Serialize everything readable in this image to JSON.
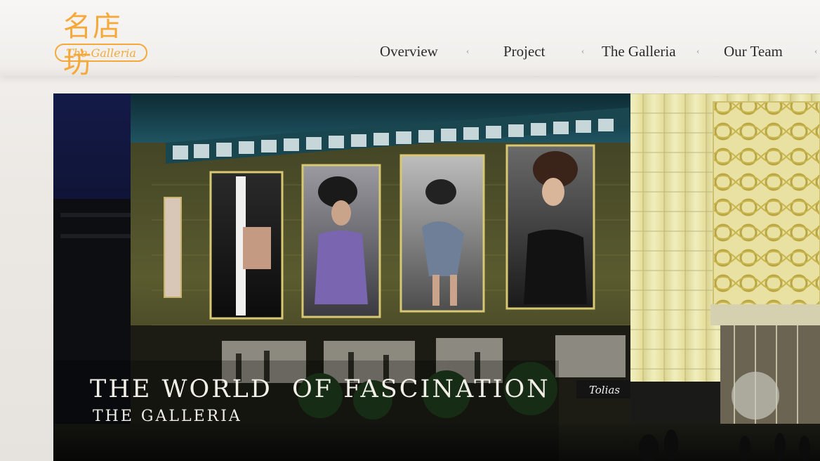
{
  "logo": {
    "chinese_name": "名店坊",
    "english_name": "The Galleria",
    "color": "#f4a93a"
  },
  "nav": {
    "items": [
      {
        "label": "Overview"
      },
      {
        "label": "Project"
      },
      {
        "label": "The Galleria"
      },
      {
        "label": "Our Team"
      }
    ],
    "separator": "‹"
  },
  "banner": {
    "headline": "THE WORLD  OF FASCINATION",
    "subline": "THE GALLERIA",
    "storefront_sign": "Tolias"
  }
}
